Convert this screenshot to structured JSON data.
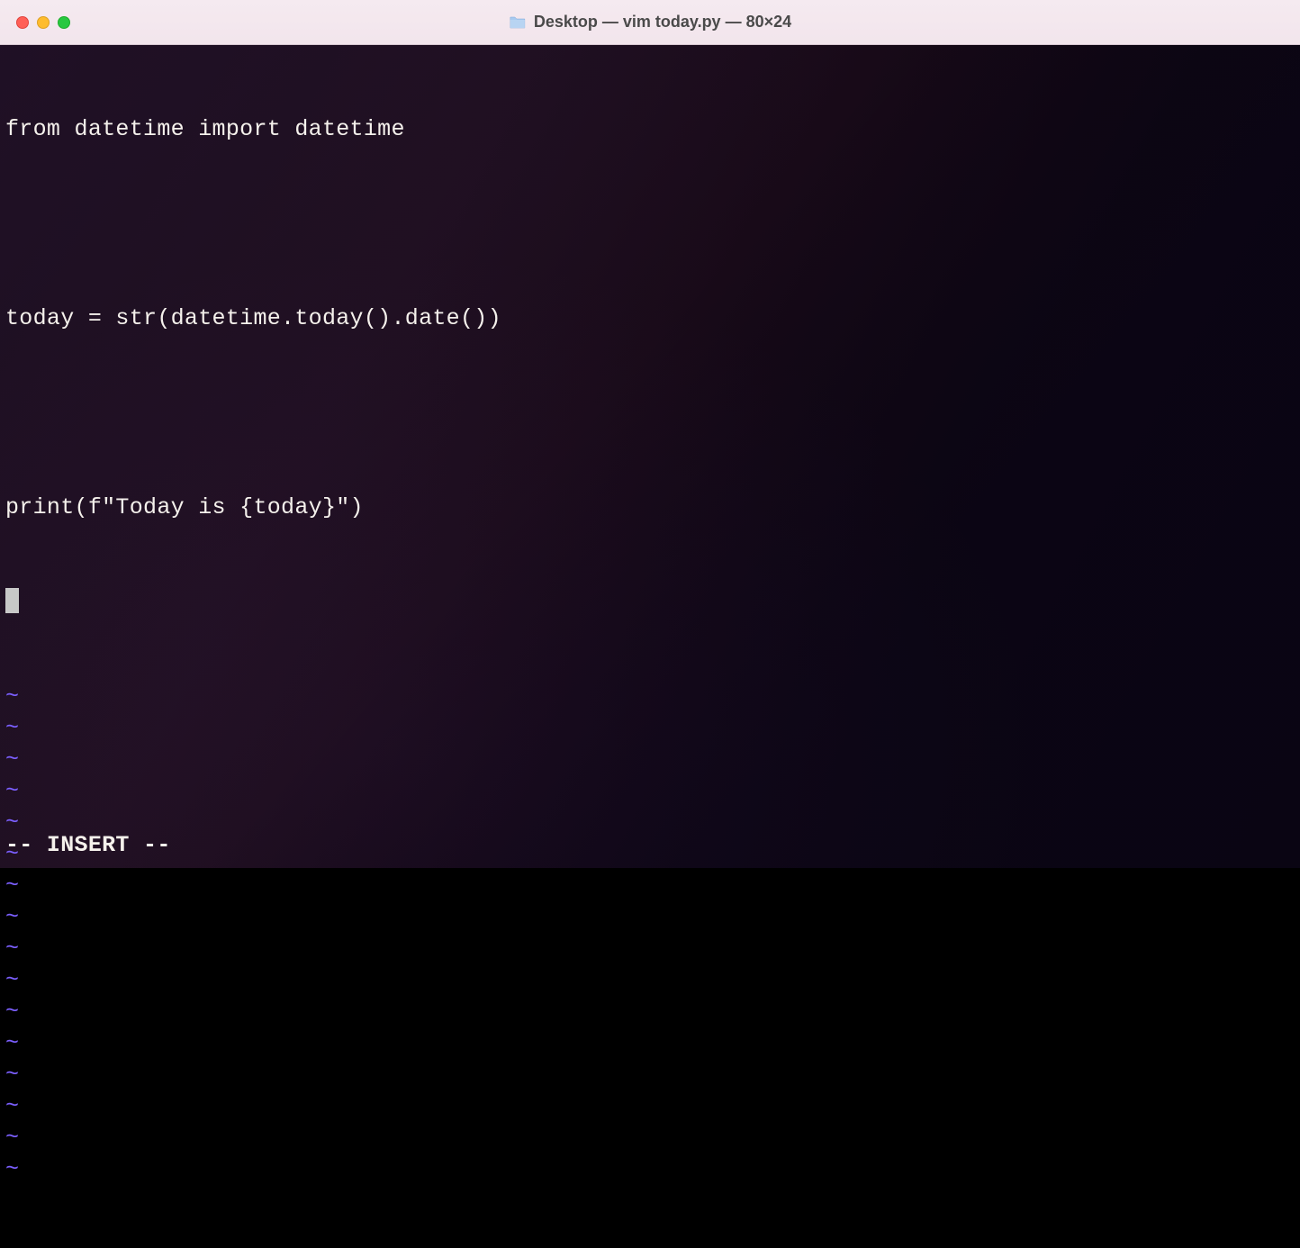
{
  "window": {
    "title": "Desktop — vim today.py — 80×24"
  },
  "editor": {
    "lines": [
      "from datetime import datetime",
      "",
      "today = str(datetime.today().date())",
      "",
      "print(f\"Today is {today}\")"
    ],
    "tilde": "~",
    "tilde_count": 16,
    "mode_status": "-- INSERT --"
  }
}
